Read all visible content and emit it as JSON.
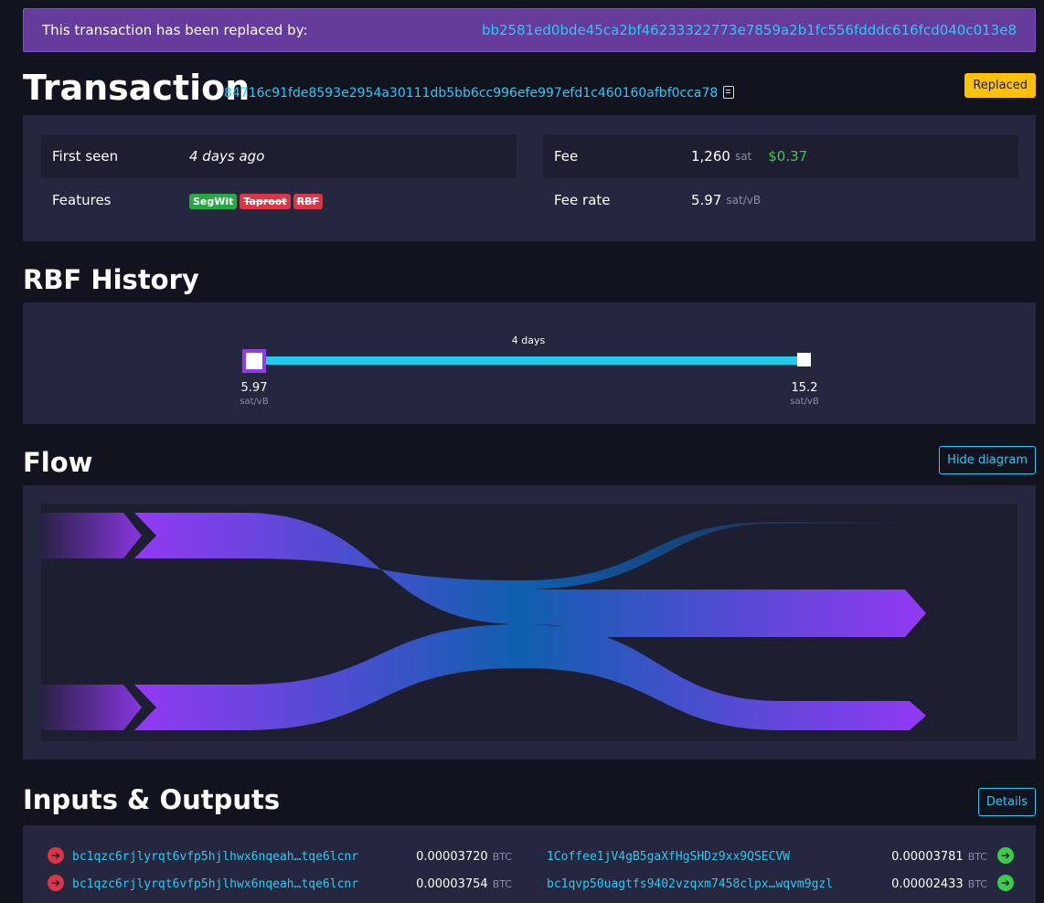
{
  "banner": {
    "text": "This transaction has been replaced by:",
    "replacement_txid": "bb2581ed0bde45ca2bf46233322773e7859a2b1fc556fdddc616fcd040c013e8"
  },
  "transaction": {
    "title": "Transaction",
    "txid": "84716c91fde8593e2954a30111db5bb6cc996efe997efd1c460160afbf0cca78",
    "status": "Replaced"
  },
  "details": {
    "first_seen_label": "First seen",
    "first_seen_value": "4 days ago",
    "features_label": "Features",
    "features": [
      {
        "label": "SegWit",
        "enabled": true
      },
      {
        "label": "Taproot",
        "enabled": false
      },
      {
        "label": "RBF",
        "enabled": false
      }
    ],
    "fee_label": "Fee",
    "fee_value": "1,260",
    "fee_unit": "sat",
    "fee_fiat": "$0.37",
    "fee_rate_label": "Fee rate",
    "fee_rate_value": "5.97",
    "fee_rate_unit": "sat/vB"
  },
  "rbf": {
    "title": "RBF History",
    "interval": "4 days",
    "start_rate": "5.97",
    "end_rate": "15.2",
    "unit": "sat/vB"
  },
  "flow": {
    "title": "Flow",
    "toggle_label": "Hide diagram",
    "inputs": [
      3.72e-05,
      3.754e-05
    ],
    "outputs": [
      0.0,
      3.781e-05,
      2.433e-05
    ]
  },
  "io": {
    "title": "Inputs & Outputs",
    "details_label": "Details",
    "unit": "BTC",
    "rows": [
      {
        "in_addr": "bc1qzc6rjlyrqt6vfp5hjlhwx6nqeah…tqe6lcnr",
        "in_amt": "0.00003720",
        "out_addr": "1Coffee1jV4gB5gaXfHgSHDz9xx9QSECVW",
        "out_amt": "0.00003781"
      },
      {
        "in_addr": "bc1qzc6rjlyrqt6vfp5hjlhwx6nqeah…tqe6lcnr",
        "in_amt": "0.00003754",
        "out_addr": "bc1qvp50uagtfs9402vzqxm7458clpx…wqvm9gzl",
        "out_amt": "0.00002433"
      }
    ]
  },
  "colors": {
    "accent": "#2ec8f4",
    "replaced_badge": "#ffc107",
    "flow_purple": "#9339f4",
    "flow_blue": "#105fb0"
  }
}
